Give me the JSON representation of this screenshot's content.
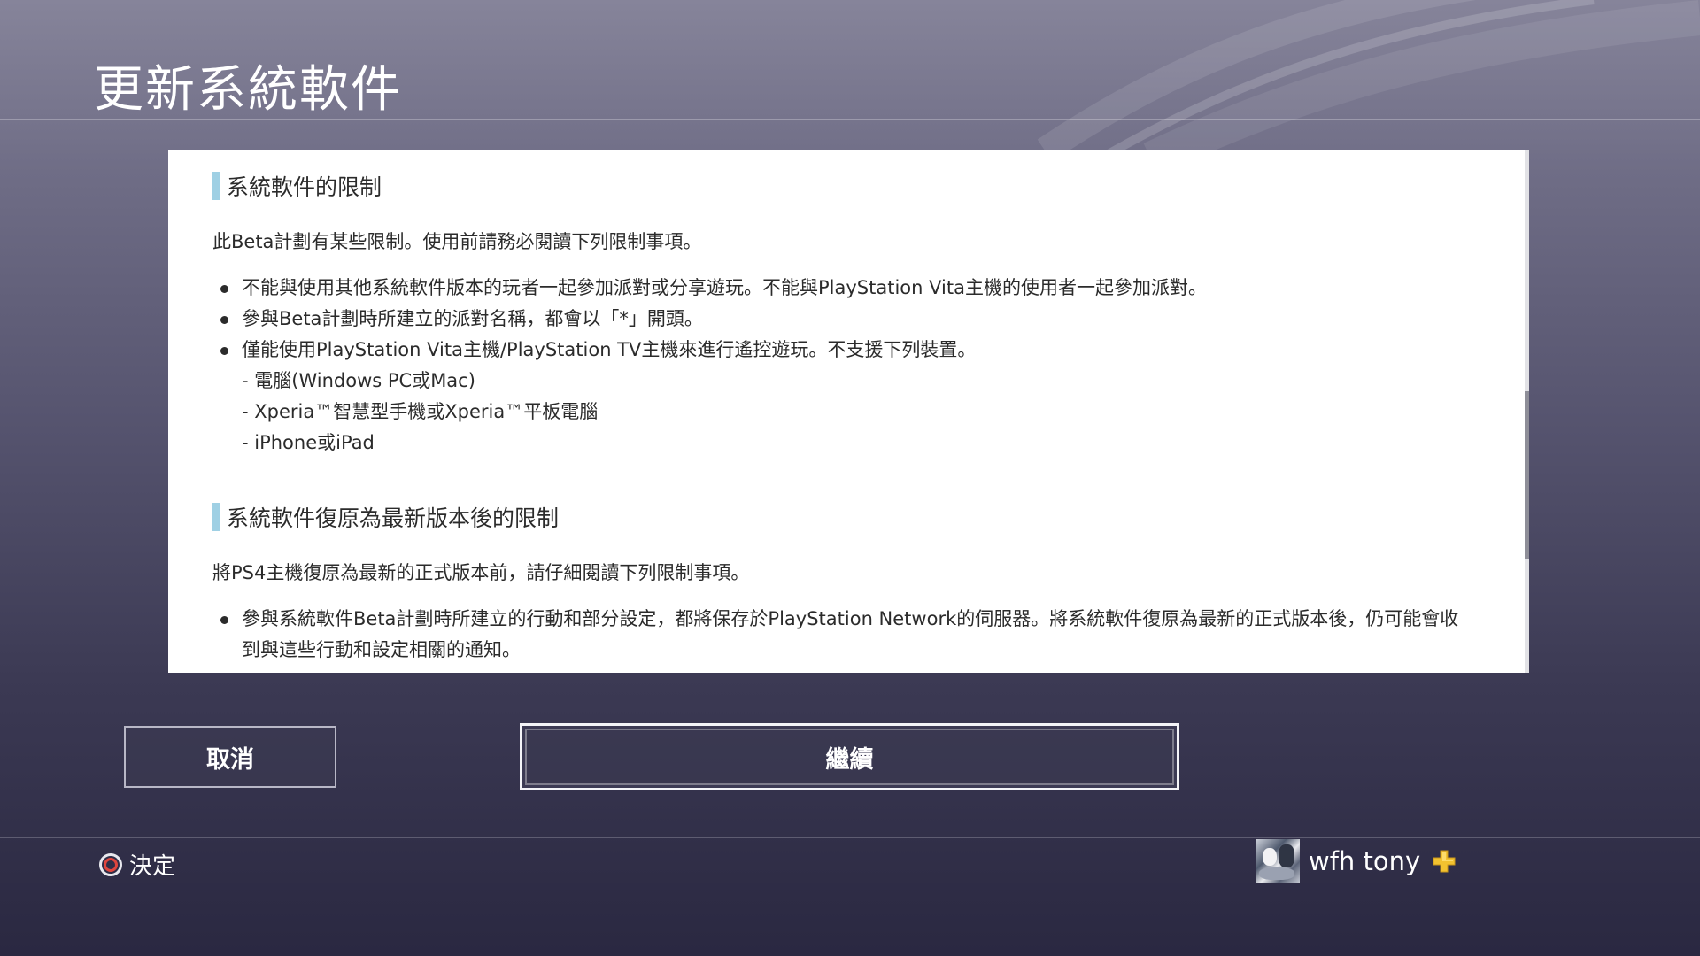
{
  "header": {
    "title": "更新系統軟件"
  },
  "panel": {
    "sections": [
      {
        "heading": "系統軟件的限制",
        "intro": "此Beta計劃有某些限制。使用前請務必閱讀下列限制事項。",
        "bullets": [
          "不能與使用其他系統軟件版本的玩者一起參加派對或分享遊玩。不能與PlayStation Vita主機的使用者一起參加派對。",
          "參與Beta計劃時所建立的派對名稱，都會以「*」開頭。",
          "僅能使用PlayStation Vita主機/PlayStation TV主機來進行遙控遊玩。不支援下列裝置。"
        ],
        "sub_items": [
          "- 電腦(Windows PC或Mac)",
          "- Xperia™智慧型手機或Xperia™平板電腦",
          "- iPhone或iPad"
        ]
      },
      {
        "heading": "系統軟件復原為最新版本後的限制",
        "intro": "將PS4主機復原為最新的正式版本前，請仔細閱讀下列限制事項。",
        "bullets": [
          "參與系統軟件Beta計劃時所建立的行動和部分設定，都將保存於PlayStation Network的伺服器。將系統軟件復原為最新的正式版本後，仍可能會收到與這些行動和設定相關的通知。"
        ]
      }
    ]
  },
  "buttons": {
    "cancel_label": "取消",
    "continue_label": "繼續"
  },
  "footer": {
    "hint_icon": "circle-button-icon",
    "hint_label": "決定",
    "username": "wfh tony",
    "plus_icon": "playstation-plus-icon"
  },
  "colors": {
    "heading_bar": "#9fd0e4",
    "circle_red": "#e0453d",
    "plus_yellow": "#f2c230"
  }
}
